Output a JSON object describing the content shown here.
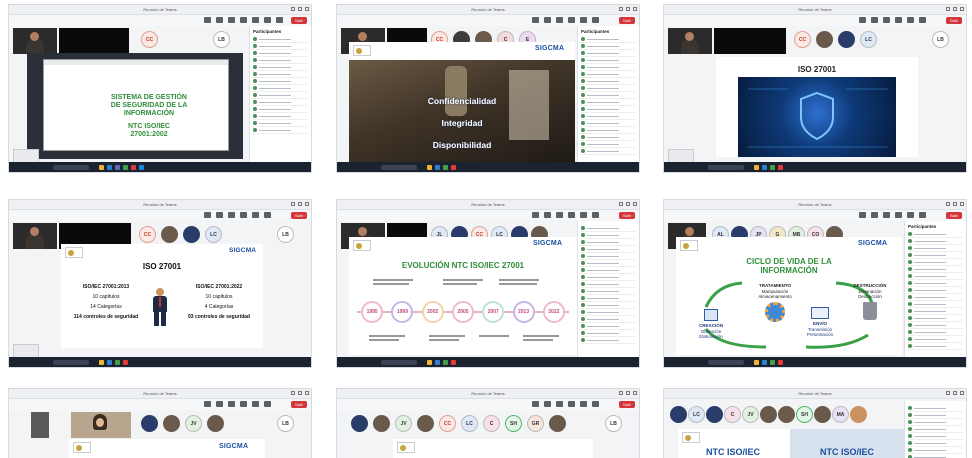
{
  "app_title": "Reunión de Teams",
  "leave_label": "Salir",
  "shots": [
    {
      "slide": {
        "title_lines": [
          "SISTEMA DE GESTIÓN",
          "DE SEGURIDAD DE LA",
          "INFORMACIÓN"
        ],
        "subtitle_lines": [
          "NTC ISO/IEC",
          "27001:2002"
        ]
      },
      "avatars": [
        "CC",
        "LB"
      ],
      "panel_title": "Participantes"
    },
    {
      "slide": {
        "brand": "SIGCMA",
        "words": [
          "Confidencialidad",
          "Integridad",
          "Disponibilidad"
        ]
      },
      "avatars": [
        "CC",
        "C",
        "E"
      ],
      "panel_title": "Participantes"
    },
    {
      "slide": {
        "title": "ISO 27001"
      },
      "avatars": [
        "CC",
        "LC",
        "LB"
      ]
    },
    {
      "slide": {
        "brand": "SIGCMA",
        "title": "ISO 27001",
        "left_head": "ISO/IEC 27001:2013",
        "left_items": [
          "10 capítulos",
          "14 Categorías",
          "114 controles de seguridad"
        ],
        "right_head": "ISO/IEC 27001:2022",
        "right_items": [
          "10 capítulos",
          "4 Categorías",
          "93 controles de seguridad"
        ]
      },
      "avatars": [
        "CC",
        "LC",
        "LB"
      ]
    },
    {
      "slide": {
        "brand": "SIGCMA",
        "title": "EVOLUCIÓN NTC ISO/IEC 27001",
        "years": [
          "1995",
          "1999",
          "2002",
          "2005",
          "2007",
          "2013",
          "2022"
        ]
      },
      "avatars": [
        "JL",
        "CC",
        "LC"
      ]
    },
    {
      "slide": {
        "brand": "SIGCMA",
        "title_lines": [
          "CICLO DE VIDA DE LA",
          "INFORMACIÓN"
        ],
        "stages": [
          {
            "head": "CREACIÓN",
            "text": [
              "Obtención",
              "Elaboración"
            ]
          },
          {
            "head": "TRATAMIENTO",
            "text": [
              "Manipulación",
              "Almacenamiento"
            ]
          },
          {
            "head": "ENVÍO",
            "text": [
              "Transmisión",
              "Presentación"
            ]
          },
          {
            "head": "DESTRUCCIÓN",
            "text": [
              "Eliminación",
              "Destrucción"
            ]
          }
        ]
      },
      "avatars": [
        "AL",
        "JP",
        "G",
        "MB",
        "CO"
      ],
      "panel_title": "Participantes"
    },
    {
      "slide": {
        "brand": "SIGCMA"
      },
      "avatars": [
        "JV",
        "LB"
      ]
    },
    {
      "slide": {},
      "avatars": [
        "JV",
        "CC",
        "LC",
        "C",
        "SH",
        "GR",
        "LB"
      ]
    },
    {
      "slide": {
        "title_a": "NTC ISO/IEC",
        "title_b": "NTC ISO/IEC"
      },
      "avatars": [
        "LC",
        "C",
        "JV",
        "SH",
        "MA"
      ]
    }
  ],
  "colors": {
    "teams_red": "#d4363b",
    "slide_green": "#2f8f3a",
    "brand_blue": "#1a4fa0",
    "cyber_blue": "#0e3a78"
  }
}
